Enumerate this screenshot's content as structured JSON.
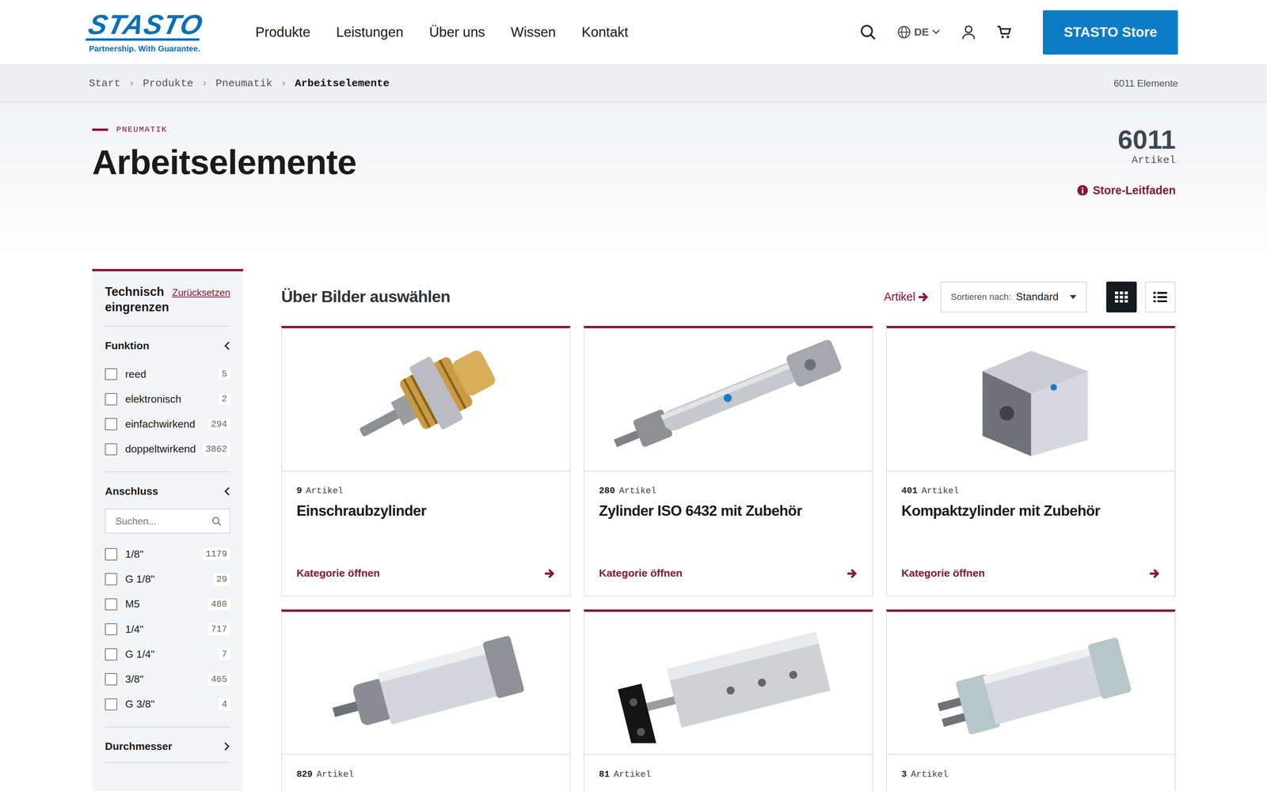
{
  "header": {
    "logo": "STASTO",
    "tagline": "Partnership. With Guarantee.",
    "nav": [
      "Produkte",
      "Leistungen",
      "Über uns",
      "Wissen",
      "Kontakt"
    ],
    "language": "DE",
    "store_button": "STASTO Store"
  },
  "breadcrumb": {
    "items": [
      {
        "label": "Start",
        "current": false
      },
      {
        "label": "Produkte",
        "current": false
      },
      {
        "label": "Pneumatik",
        "current": false
      },
      {
        "label": "Arbeitselemente",
        "current": true
      }
    ],
    "separator": "›",
    "count": "6011 Elemente"
  },
  "hero": {
    "eyebrow": "PNEUMATIK",
    "title": "Arbeitselemente",
    "count": "6011",
    "count_label": "Artikel",
    "guide": "Store-Leitfaden"
  },
  "sidebar": {
    "title": "Technisch eingrenzen",
    "reset": "Zurücksetzen",
    "sections": [
      {
        "title": "Funktion",
        "expanded": true,
        "options": [
          {
            "label": "reed",
            "count": "5",
            "checked": false
          },
          {
            "label": "elektronisch",
            "count": "2",
            "checked": false
          },
          {
            "label": "einfachwirkend",
            "count": "294",
            "checked": false
          },
          {
            "label": "doppeltwirkend",
            "count": "3862",
            "checked": false
          }
        ]
      },
      {
        "title": "Anschluss",
        "expanded": true,
        "search_placeholder": "Suchen...",
        "options": [
          {
            "label": "1/8\"",
            "count": "1179",
            "checked": false
          },
          {
            "label": "G 1/8\"",
            "count": "29",
            "checked": false
          },
          {
            "label": "M5",
            "count": "480",
            "checked": false
          },
          {
            "label": "1/4\"",
            "count": "717",
            "checked": false
          },
          {
            "label": "G 1/4\"",
            "count": "7",
            "checked": false
          },
          {
            "label": "3/8\"",
            "count": "465",
            "checked": false
          },
          {
            "label": "G 3/8\"",
            "count": "4",
            "checked": false
          }
        ]
      },
      {
        "title": "Durchmesser",
        "expanded": false,
        "options": []
      }
    ]
  },
  "main": {
    "title": "Über Bilder auswählen",
    "articles_link": "Artikel",
    "sort": {
      "label": "Sortieren nach:",
      "value": "Standard"
    },
    "views": [
      {
        "name": "grid",
        "selected": true
      },
      {
        "name": "list",
        "selected": false
      }
    ],
    "cards": [
      {
        "count": "9",
        "count_label": "Artikel",
        "title": "Einschraubzylinder",
        "link": "Kategorie öffnen"
      },
      {
        "count": "280",
        "count_label": "Artikel",
        "title": "Zylinder ISO 6432 mit Zubehör",
        "link": "Kategorie öffnen"
      },
      {
        "count": "401",
        "count_label": "Artikel",
        "title": "Kompaktzylinder mit Zubehör",
        "link": "Kategorie öffnen"
      },
      {
        "count": "829",
        "count_label": "Artikel"
      },
      {
        "count": "81",
        "count_label": "Artikel"
      },
      {
        "count": "3",
        "count_label": "Artikel"
      }
    ]
  }
}
